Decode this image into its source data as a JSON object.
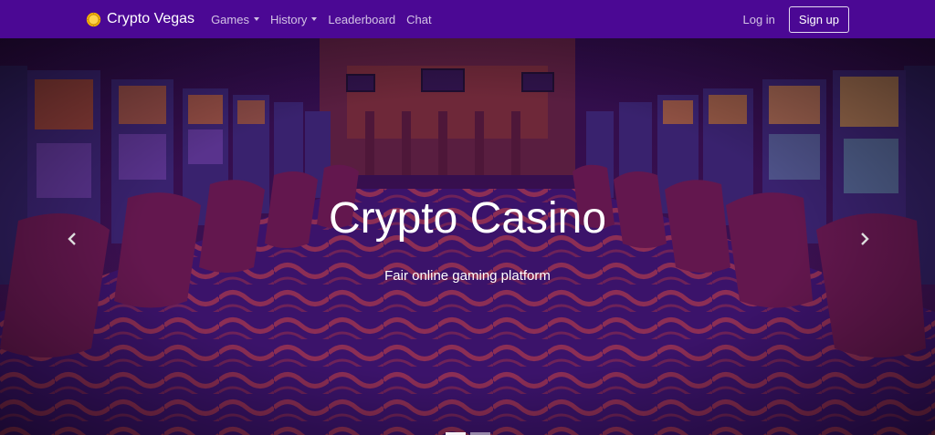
{
  "navbar": {
    "brand": "Crypto Vegas",
    "brand_icon": "coin-icon",
    "links": [
      {
        "label": "Games",
        "dropdown": true
      },
      {
        "label": "History",
        "dropdown": true
      },
      {
        "label": "Leaderboard",
        "dropdown": false
      },
      {
        "label": "Chat",
        "dropdown": false
      }
    ],
    "login": "Log in",
    "signup": "Sign up"
  },
  "hero": {
    "title": "Crypto Casino",
    "subtitle": "Fair online gaming platform",
    "prev_icon": "chevron-left-icon",
    "next_icon": "chevron-right-icon",
    "slides_count": 2,
    "active_slide": 0
  },
  "colors": {
    "navbar_bg": "#4b0894",
    "overlay": "#3a0a6a"
  }
}
